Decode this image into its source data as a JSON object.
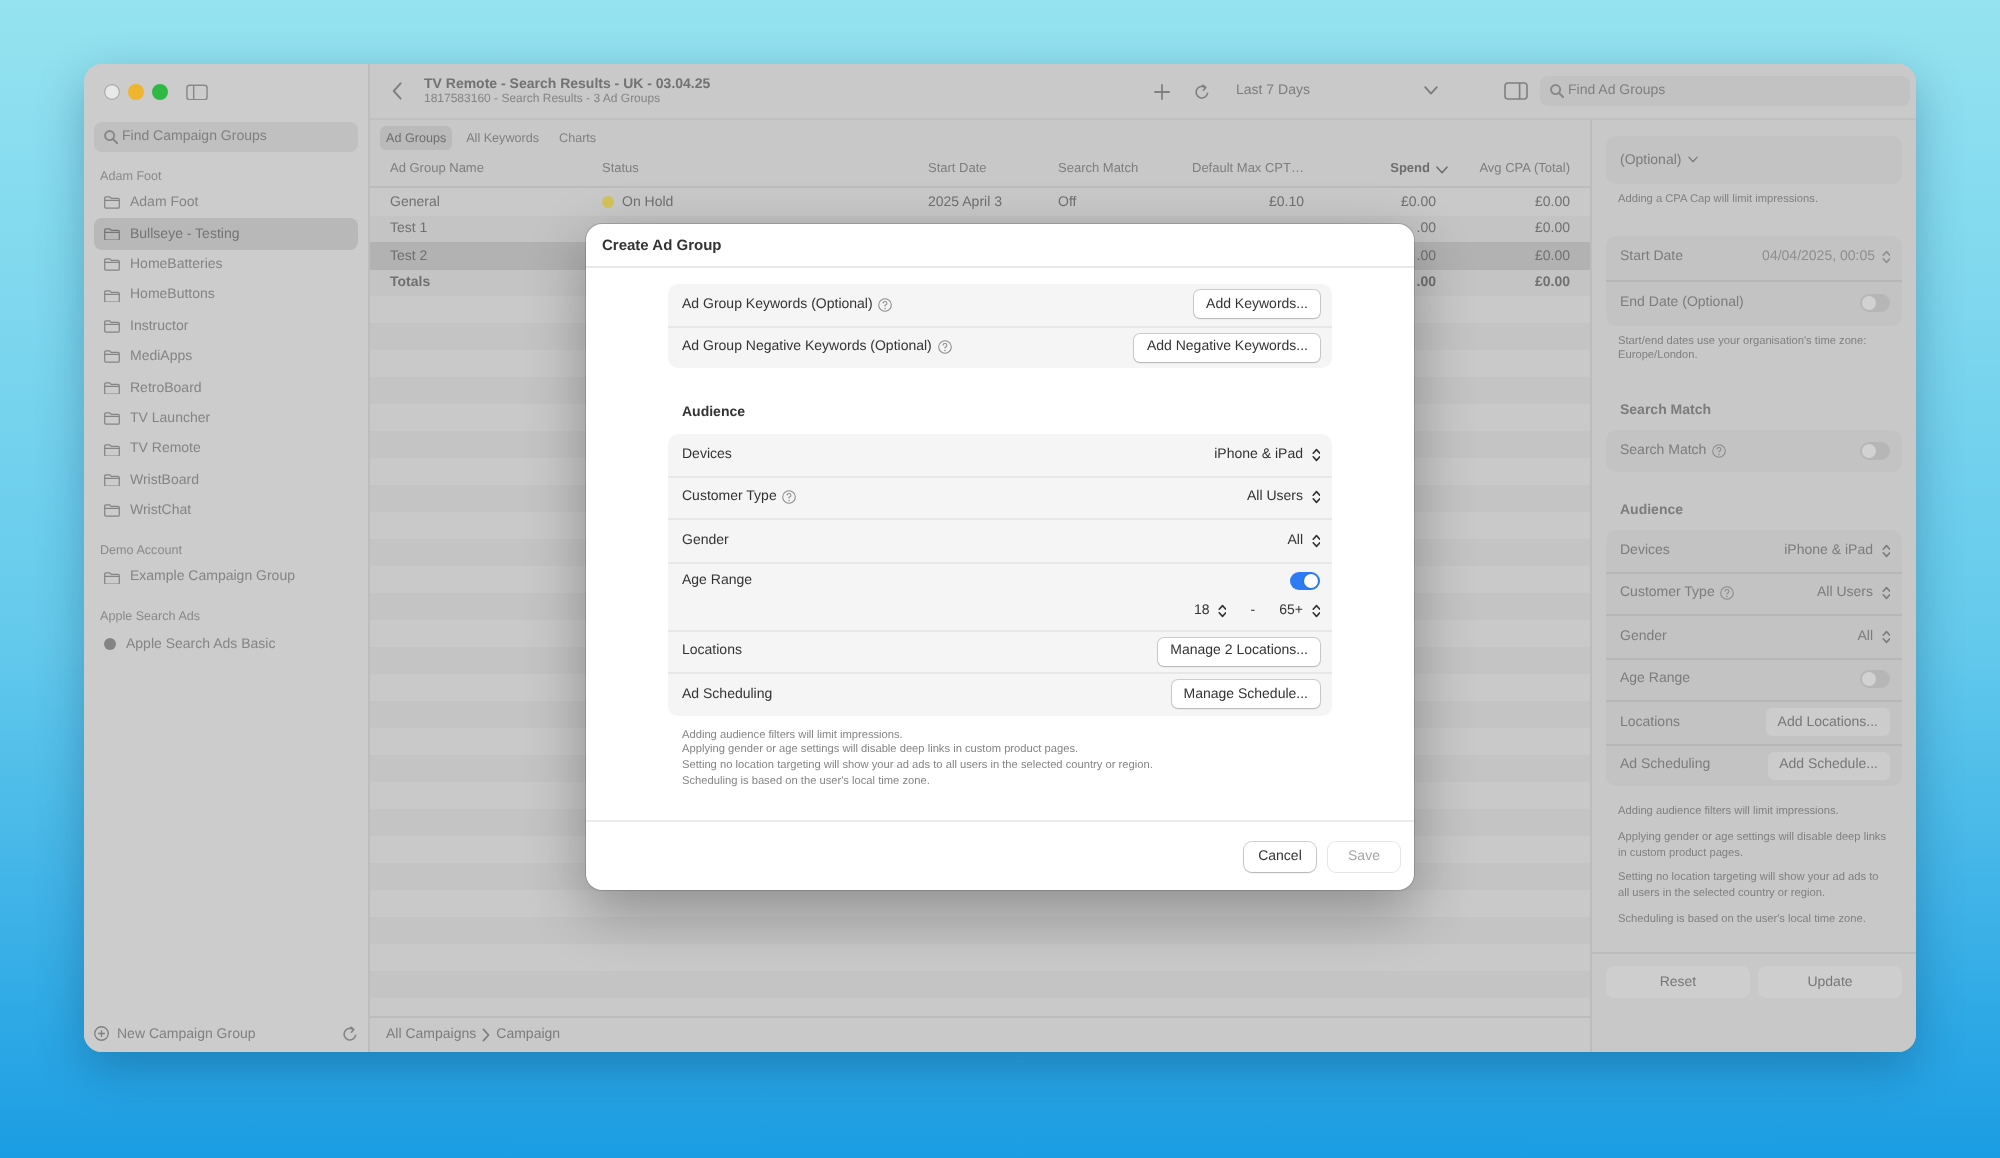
{
  "sidebar": {
    "search": {
      "placeholder": "Find Campaign Groups"
    },
    "sections": [
      {
        "title": "Adam Foot",
        "items": [
          {
            "label": "Adam Foot",
            "kind": "folder",
            "selected": false
          },
          {
            "label": "Bullseye - Testing",
            "kind": "folder",
            "selected": true
          },
          {
            "label": "HomeBatteries",
            "kind": "folder",
            "selected": false
          },
          {
            "label": "HomeButtons",
            "kind": "folder",
            "selected": false
          },
          {
            "label": "Instructor",
            "kind": "folder",
            "selected": false
          },
          {
            "label": "MediApps",
            "kind": "folder",
            "selected": false
          },
          {
            "label": "RetroBoard",
            "kind": "folder",
            "selected": false
          },
          {
            "label": "TV Launcher",
            "kind": "folder",
            "selected": false
          },
          {
            "label": "TV Remote",
            "kind": "folder",
            "selected": false
          },
          {
            "label": "WristBoard",
            "kind": "folder",
            "selected": false
          },
          {
            "label": "WristChat",
            "kind": "folder",
            "selected": false
          }
        ]
      },
      {
        "title": "Demo Account",
        "items": [
          {
            "label": "Example Campaign Group",
            "kind": "folder",
            "selected": false
          }
        ]
      },
      {
        "title": "Apple Search Ads",
        "items": [
          {
            "label": "Apple Search Ads Basic",
            "kind": "account",
            "selected": false
          }
        ]
      }
    ],
    "new_button": "New Campaign Group"
  },
  "toolbar": {
    "title": "TV Remote - Search Results - UK - 03.04.25",
    "subtitle": "1817583160 - Search Results - 3 Ad Groups",
    "date_range": "Last 7 Days",
    "search": {
      "placeholder": "Find Ad Groups"
    }
  },
  "tabs": [
    {
      "label": "Ad Groups",
      "selected": true
    },
    {
      "label": "All Keywords",
      "selected": false
    },
    {
      "label": "Charts",
      "selected": false
    }
  ],
  "table": {
    "columns": [
      {
        "label": "Ad Group Name",
        "sorted": false
      },
      {
        "label": "Status",
        "sorted": false
      },
      {
        "label": "Start Date",
        "sorted": false
      },
      {
        "label": "Search Match",
        "sorted": false
      },
      {
        "label": "Default Max CPT…",
        "sorted": false
      },
      {
        "label": "Spend",
        "sorted": true
      },
      {
        "label": "Avg CPA (Total)",
        "sorted": false
      }
    ],
    "rows": [
      {
        "kind": "ad_group",
        "selected": false,
        "name": "General",
        "status": {
          "label": "On Hold",
          "color": "#d4c35b"
        },
        "start_date": "2025 April 3",
        "search_match": "Off",
        "default_max_cpt": "£0.10",
        "spend": "£0.00",
        "avg_cpa": "£0.00"
      },
      {
        "kind": "ad_group",
        "selected": false,
        "name": "Test 1",
        "spend": ".00",
        "avg_cpa": "£0.00"
      },
      {
        "kind": "ad_group",
        "selected": true,
        "name": "Test 2",
        "spend": ".00",
        "avg_cpa": "£0.00"
      },
      {
        "kind": "total",
        "selected": false,
        "name": "Totals",
        "spend": ".00",
        "avg_cpa": "£0.00"
      }
    ]
  },
  "breadcrumb": [
    "All Campaigns",
    "Campaign"
  ],
  "inspector": {
    "top_field": {
      "label": "(Optional)"
    },
    "cpa_note": "Adding a CPA Cap will limit impressions.",
    "dates": [
      {
        "label": "Start Date",
        "kind": "date",
        "info": false,
        "value": "04/04/2025, 00:05",
        "disabled": true
      },
      {
        "label": "End Date (Optional)",
        "kind": "toggle",
        "info": false,
        "on": false
      }
    ],
    "dates_note": "Start/end dates use your organisation's time zone: Europe/London.",
    "search_match": {
      "heading": "Search Match",
      "rows": [
        {
          "label": "Search Match",
          "kind": "toggle",
          "info": true,
          "on": false
        }
      ]
    },
    "audience": {
      "heading": "Audience",
      "rows": [
        {
          "label": "Devices",
          "kind": "select",
          "info": false,
          "value": "iPhone & iPad"
        },
        {
          "label": "Customer Type",
          "kind": "select",
          "info": true,
          "value": "All Users"
        },
        {
          "label": "Gender",
          "kind": "select",
          "info": false,
          "value": "All"
        },
        {
          "label": "Age Range",
          "kind": "toggle",
          "info": false,
          "on": false
        },
        {
          "label": "Locations",
          "kind": "button",
          "info": false,
          "value": "Add Locations..."
        },
        {
          "label": "Ad Scheduling",
          "kind": "button",
          "info": false,
          "value": "Add Schedule..."
        }
      ]
    },
    "notes": [
      "Adding audience filters will limit impressions.",
      "Applying gender or age settings will disable deep links in custom product pages.",
      "Setting no location targeting will show your ad ads to all users in the selected country or region.",
      "Scheduling is based on the user's local time zone."
    ],
    "buttons": [
      {
        "label": "Reset",
        "disabled": false
      },
      {
        "label": "Update",
        "disabled": false
      }
    ]
  },
  "dialog": {
    "title": "Create Ad Group",
    "keywords": {
      "rows": [
        {
          "label": "Ad Group Keywords (Optional)",
          "kind": "button",
          "info": true,
          "value": "Add Keywords..."
        },
        {
          "label": "Ad Group Negative Keywords (Optional)",
          "kind": "button",
          "info": true,
          "value": "Add Negative Keywords..."
        }
      ]
    },
    "audience": {
      "heading": "Audience",
      "rows": [
        {
          "label": "Devices",
          "kind": "select",
          "info": false,
          "value": "iPhone & iPad"
        },
        {
          "label": "Customer Type",
          "kind": "select",
          "info": true,
          "value": "All Users"
        },
        {
          "label": "Gender",
          "kind": "select",
          "info": false,
          "value": "All"
        },
        {
          "label": "Age Range",
          "kind": "age_range",
          "info": false,
          "on": true,
          "min": "18",
          "separator": "-",
          "max": "65+"
        },
        {
          "label": "Locations",
          "kind": "button",
          "info": false,
          "value": "Manage 2 Locations..."
        },
        {
          "label": "Ad Scheduling",
          "kind": "button",
          "info": false,
          "value": "Manage Schedule..."
        }
      ]
    },
    "notes": [
      "Adding audience filters will limit impressions.",
      "Applying gender or age settings will disable deep links in custom product pages.",
      "Setting no location targeting will show your ad ads to all users in the selected country or region.",
      "Scheduling is based on the user's local time zone."
    ],
    "buttons": [
      {
        "label": "Cancel",
        "disabled": false
      },
      {
        "label": "Save",
        "disabled": true
      }
    ]
  }
}
